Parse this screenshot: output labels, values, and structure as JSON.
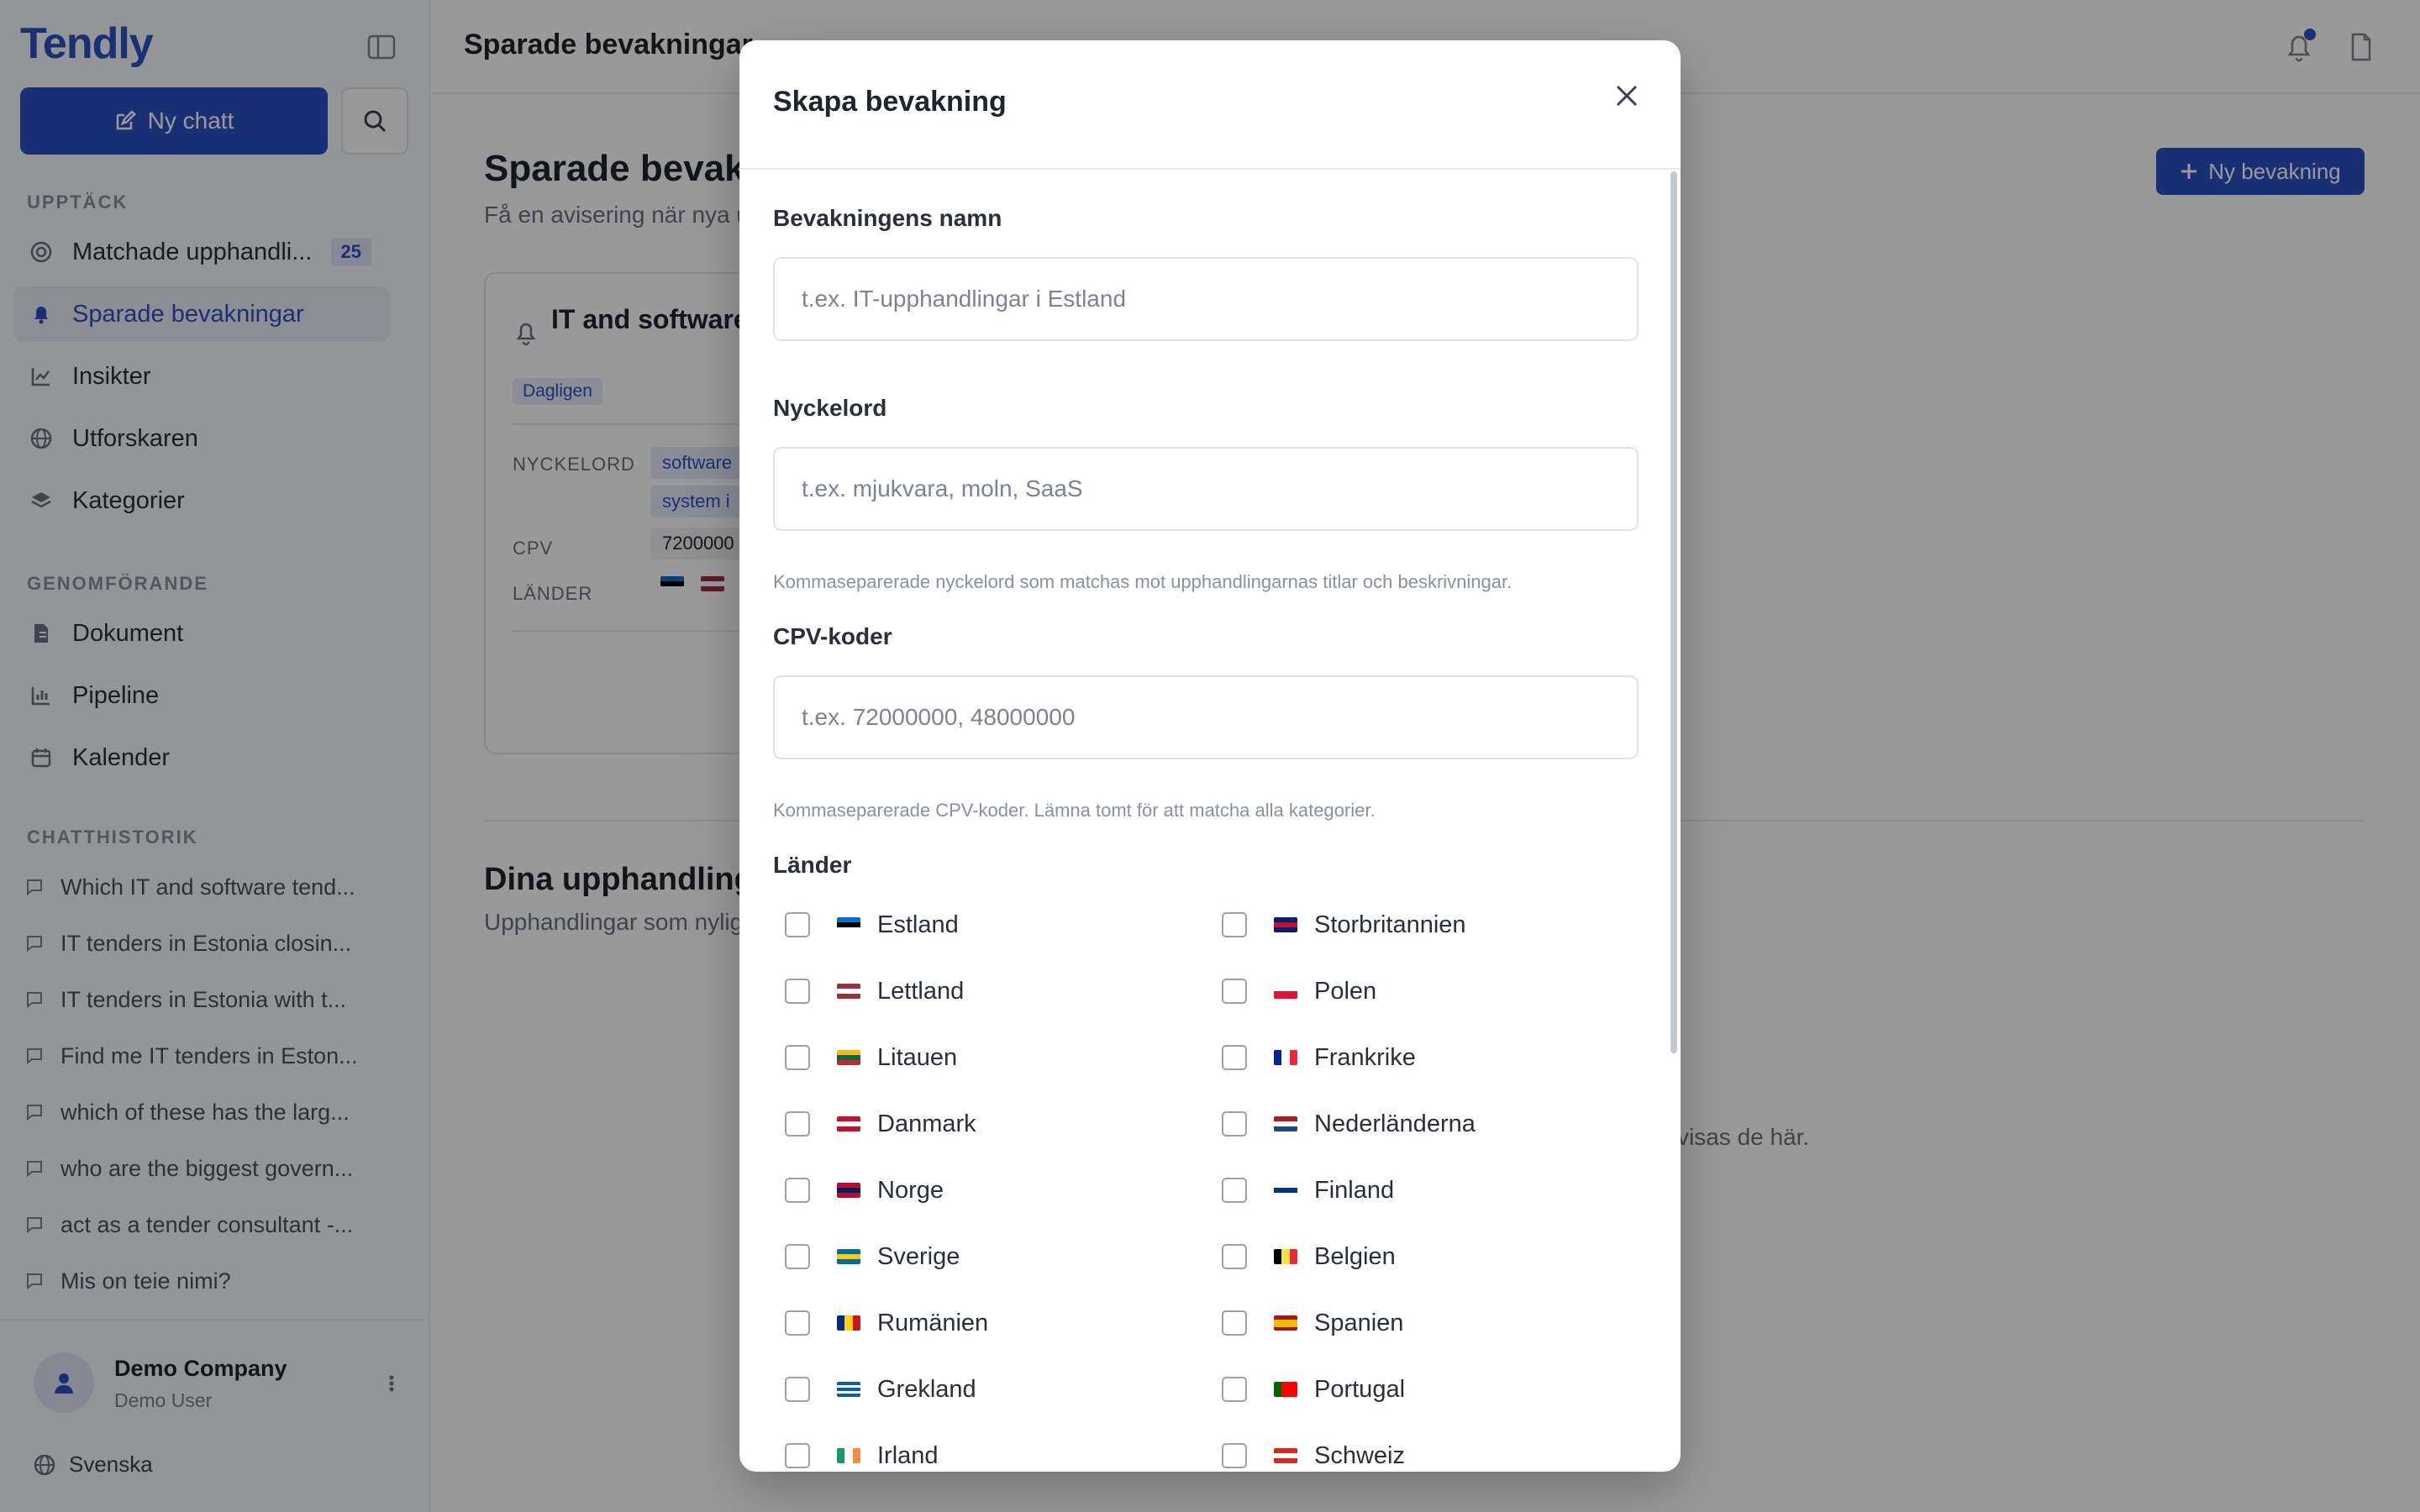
{
  "sidebar": {
    "logo": "Tendly",
    "new_chat_label": "Ny chatt",
    "sections": {
      "discover": "UPPTÄCK",
      "execution": "GENOMFÖRANDE",
      "history": "CHATTHISTORIK"
    },
    "discover_items": [
      {
        "label": "Matchade upphandli...",
        "badge": "25",
        "icon": "target-icon"
      },
      {
        "label": "Sparade bevakningar",
        "icon": "bell-icon",
        "active": true
      },
      {
        "label": "Insikter",
        "icon": "chart-line-icon"
      },
      {
        "label": "Utforskaren",
        "icon": "globe-icon"
      },
      {
        "label": "Kategorier",
        "icon": "layers-icon"
      }
    ],
    "execution_items": [
      {
        "label": "Dokument",
        "icon": "document-icon"
      },
      {
        "label": "Pipeline",
        "icon": "bar-chart-icon"
      },
      {
        "label": "Kalender",
        "icon": "calendar-icon"
      }
    ],
    "chat_history": [
      "Which IT and software tend...",
      "IT tenders in Estonia closin...",
      "IT tenders in Estonia with t...",
      "Find me IT tenders in Eston...",
      "which of these has the larg...",
      "who are the biggest govern...",
      "act as a tender consultant -...",
      "Mis on teie nimi?"
    ],
    "company": "Demo Company",
    "user": "Demo User",
    "language": "Svenska"
  },
  "topbar": {
    "title": "Sparade bevakningar"
  },
  "main": {
    "heading": "Sparade bevakn",
    "subtitle": "Få en avisering när nya u",
    "new_watch_label": "Ny bevakning",
    "watch_card": {
      "title": "IT and software Baltics",
      "frequency": "Dagligen",
      "keywords_label": "NYCKELORD",
      "keywords": [
        "software",
        "system i"
      ],
      "cpv_label": "CPV",
      "cpv_value": "7200000",
      "countries_label": "LÄNDER"
    },
    "section2_heading": "Dina upphandlings",
    "section2_subtitle": "Upphandlingar som nylig",
    "empty_text": "visas de här."
  },
  "modal": {
    "title": "Skapa bevakning",
    "name_label": "Bevakningens namn",
    "name_placeholder": "t.ex. IT-upphandlingar i Estland",
    "keywords_label": "Nyckelord",
    "keywords_placeholder": "t.ex. mjukvara, moln, SaaS",
    "keywords_help": "Kommaseparerade nyckelord som matchas mot upphandlingarnas titlar och beskrivningar.",
    "cpv_label": "CPV-koder",
    "cpv_placeholder": "t.ex. 72000000, 48000000",
    "cpv_help": "Kommaseparerade CPV-koder. Lämna tomt för att matcha alla kategorier.",
    "countries_label": "Länder",
    "countries_left": [
      "Estland",
      "Lettland",
      "Litauen",
      "Danmark",
      "Norge",
      "Sverige",
      "Rumänien",
      "Grekland",
      "Irland"
    ],
    "countries_right": [
      "Storbritannien",
      "Polen",
      "Frankrike",
      "Nederländerna",
      "Finland",
      "Belgien",
      "Spanien",
      "Portugal",
      "Schweiz"
    ]
  },
  "colors": {
    "accent": "#2b50c4",
    "accent_light": "#e6ecfa",
    "overlay": "rgba(0,0,0,0.40)"
  }
}
